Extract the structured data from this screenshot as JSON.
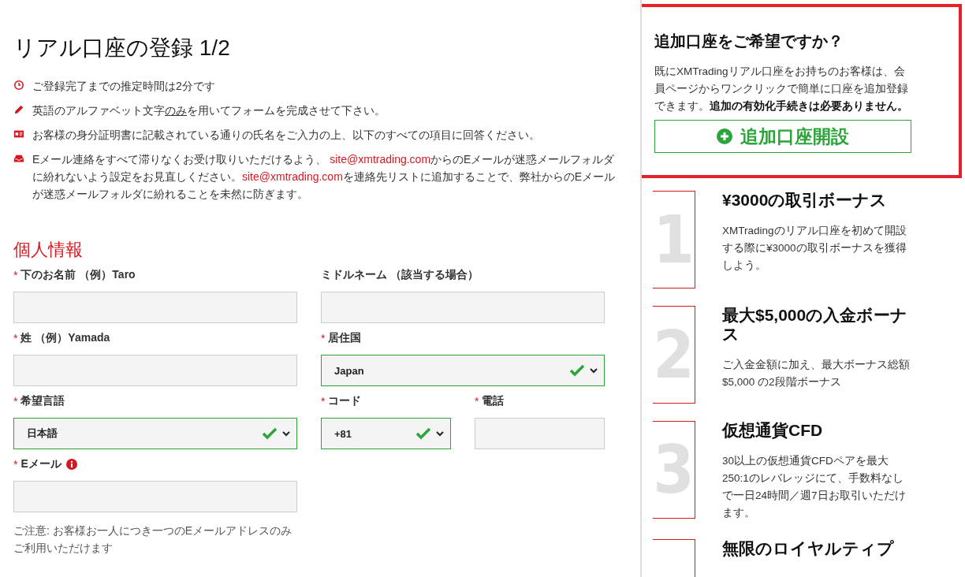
{
  "title": "リアル口座の登録 1/2",
  "notes": [
    {
      "kind": "time",
      "parts": [
        {
          "kind": "plain",
          "text": "ご登録完了までの推定時間は2分です"
        }
      ]
    },
    {
      "kind": "language",
      "parts": [
        {
          "kind": "plain",
          "text": "英語のアルファベット文字"
        },
        {
          "kind": "underline",
          "text": "のみ"
        },
        {
          "kind": "plain",
          "text": "を用いてフォームを完成させて下さい。"
        }
      ]
    },
    {
      "kind": "name",
      "parts": [
        {
          "kind": "plain",
          "text": "お客様の身分証明書に記載されている通りの氏名をご入力の上、以下のすべての項目に回答ください。"
        }
      ]
    },
    {
      "kind": "email",
      "parts": [
        {
          "kind": "plain",
          "text": "Eメール連絡をすべて滞りなくお受け取りいただけるよう、 "
        },
        {
          "kind": "link",
          "text": "site@xmtrading.com"
        },
        {
          "kind": "plain",
          "text": "からのEメールが迷惑メールフォルダに紛れないよう設定をお見直しください。"
        },
        {
          "kind": "link",
          "text": "site@xmtrading.com"
        },
        {
          "kind": "plain",
          "text": "を連絡先リストに追加することで、弊社からのEメールが迷惑メールフォルダに紛れることを未然に防ぎます。"
        }
      ]
    }
  ],
  "section_title": "個人情報",
  "form_rows": [
    [
      {
        "kind": "text",
        "label": "下のお名前 （例）Taro",
        "marker": "*"
      },
      {
        "kind": "text",
        "label": "ミドルネーム （該当する場合）"
      }
    ],
    [
      {
        "kind": "text",
        "label": "姓 （例）Yamada",
        "marker": "*"
      },
      {
        "kind": "select",
        "label": "居住国",
        "marker": "*",
        "value": "Japan",
        "valid": true
      }
    ],
    [
      {
        "kind": "select",
        "label": "希望言語",
        "marker": "*",
        "value": "日本語",
        "valid": true
      },
      {
        "kind": "code",
        "label": "コード",
        "marker": "*",
        "value": "+81",
        "valid": true
      },
      {
        "kind": "phone",
        "label": "電話",
        "marker": "*"
      }
    ],
    [
      {
        "kind": "text",
        "label": "Eメール",
        "marker": "*",
        "info": true,
        "note": "ご注意: お客様お一人につき一つのEメールアドレスのみご利用いただけます"
      }
    ]
  ],
  "promo": {
    "title": "追加口座をご希望ですか？",
    "text": "既にXMTradingリアル口座をお持ちのお客様は、会員ページからワンクリックで簡単に口座を追加登録できます。**追加の有効化手続きは必要ありません。**",
    "button": "追加口座開設"
  },
  "benefits": [
    {
      "number": "1",
      "title": "¥3000の取引ボーナス",
      "text": "XMTradingのリアル口座を初めて開設する際に¥3000の取引ボーナスを獲得しよう。"
    },
    {
      "number": "2",
      "title": "最大$5,000の入金ボーナス",
      "text": "ご入金金額に加え、最大ボーナス総額$5,000 の2段階ボーナス"
    },
    {
      "number": "3",
      "title": "仮想通貨CFD",
      "text": "30以上の仮想通貨CFDペアを最大250:1のレバレッジにて、手数料なしで一日24時間／週7日お取引いただけます。"
    },
    {
      "title": "無限のロイヤルティプ"
    }
  ]
}
